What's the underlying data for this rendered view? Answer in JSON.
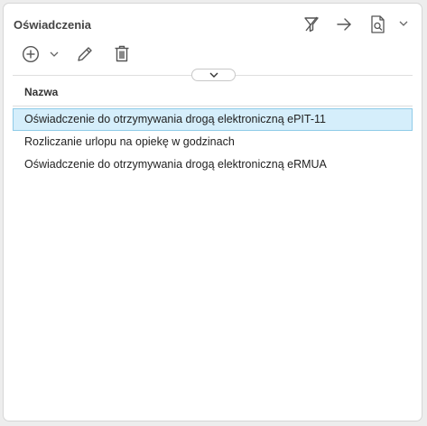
{
  "panel": {
    "title": "Oświadczenia"
  },
  "header_icons": [
    "filter-off-icon",
    "arrow-right-icon",
    "document-search-icon",
    "chevron-down-icon"
  ],
  "toolbar": {
    "icons": [
      "add-circle-icon",
      "chevron-down-icon",
      "pencil-icon",
      "trash-icon"
    ]
  },
  "table": {
    "column_header": "Nazwa",
    "rows": [
      "Oświadczenie do otrzymywania drogą elektroniczną ePIT-11",
      "Rozliczanie urlopu na opiekę w godzinach",
      "Oświadczenie do otrzymywania drogą elektroniczną eRMUA"
    ],
    "selected_row": 0
  },
  "colors": {
    "selection_bg": "#d5eefb",
    "selection_border": "#8fcbe8",
    "icon": "#555555"
  }
}
